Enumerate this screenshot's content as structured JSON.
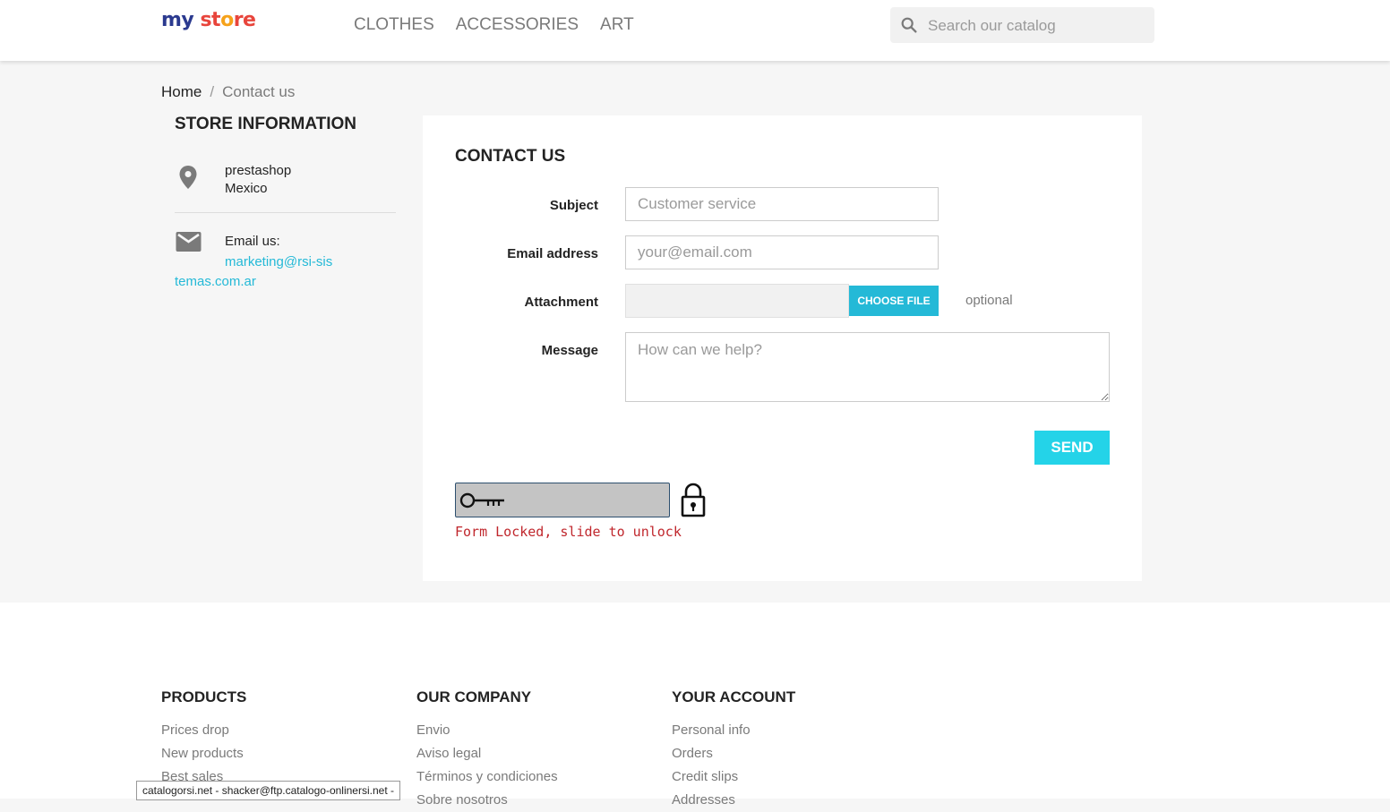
{
  "header": {
    "logo": {
      "part1": "my",
      "part2": "st",
      "part3": "o",
      "part4": "re"
    },
    "nav": [
      "CLOTHES",
      "ACCESSORIES",
      "ART"
    ],
    "search_placeholder": "Search our catalog"
  },
  "breadcrumb": {
    "home": "Home",
    "separator": "/",
    "current": "Contact us"
  },
  "store": {
    "title": "STORE INFORMATION",
    "address_line1": "prestashop",
    "address_line2": "Mexico",
    "email_label": "Email us:",
    "email": "marketing@rsi-sistemas.com.ar"
  },
  "contact": {
    "title": "CONTACT US",
    "subject_label": "Subject",
    "subject_value": "Customer service",
    "email_label": "Email address",
    "email_placeholder": "your@email.com",
    "attachment_label": "Attachment",
    "choose_file": "CHOOSE FILE",
    "optional": "optional",
    "message_label": "Message",
    "message_placeholder": "How can we help?",
    "send": "SEND",
    "locked_msg": "Form Locked, slide to unlock"
  },
  "footer": {
    "products": {
      "title": "PRODUCTS",
      "links": [
        "Prices drop",
        "New products",
        "Best sales"
      ]
    },
    "company": {
      "title": "OUR COMPANY",
      "links": [
        "Envio",
        "Aviso legal",
        "Términos y condiciones",
        "Sobre nosotros"
      ]
    },
    "account": {
      "title": "YOUR ACCOUNT",
      "links": [
        "Personal info",
        "Orders",
        "Credit slips",
        "Addresses"
      ]
    }
  },
  "status_bar": "catalogorsi.net - shacker@ftp.catalogo-onlinersi.net -",
  "colors": {
    "accent": "#24b9d7",
    "send": "#24d3e8",
    "error": "#c0272d"
  }
}
